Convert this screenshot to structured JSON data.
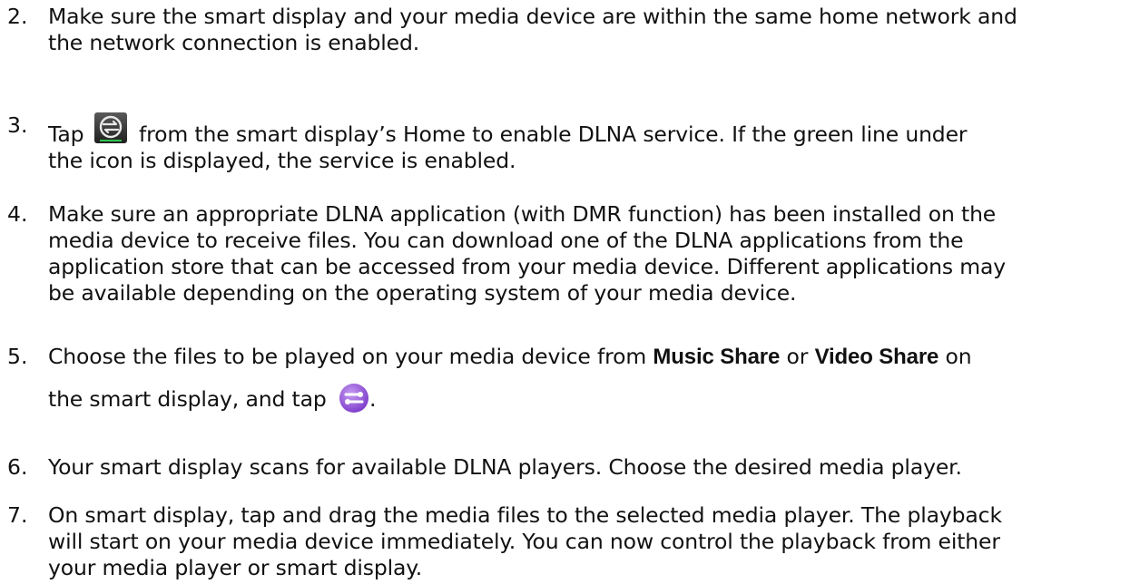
{
  "steps": [
    {
      "number": "2.",
      "lines": [
        "Make sure the smart display and your media device are within the same home network and",
        "the network connection is enabled."
      ]
    },
    {
      "number": "3.",
      "before_icon": "Tap",
      "icon": "dlna-app-icon",
      "after_icon": "from the smart display’s Home to enable DLNA service. If the green line under",
      "line2": "the icon is displayed, the service is enabled."
    },
    {
      "number": "4.",
      "lines": [
        "Make sure an appropriate DLNA application (with DMR function) has been installed on the",
        "media device to receive files. You can download one of the DLNA applications from the",
        "application store that can be accessed from your media device. Different applications may",
        "be available depending on the operating system of your media device."
      ]
    },
    {
      "number": "5.",
      "part1": "Choose the files to be played on your media device from",
      "music_share": "Music Share",
      "or": "or",
      "video_share": "Video Share",
      "on": "on",
      "line2_before_icon": "the smart display, and tap",
      "icon": "share-icon",
      "line2_after_icon": "."
    },
    {
      "number": "6.",
      "lines": [
        "Your smart display scans for available DLNA players. Choose the desired media player."
      ]
    },
    {
      "number": "7.",
      "lines": [
        "On smart display, tap and drag the media files to the selected media player. The playback",
        "will start on your media device immediately. You can now control the playback from either",
        "your media player or smart display."
      ]
    }
  ],
  "colors": {
    "text": "#111111",
    "dlna_icon_bg": "#3a3a3a",
    "share_icon_bg": "#8b4bd6"
  }
}
